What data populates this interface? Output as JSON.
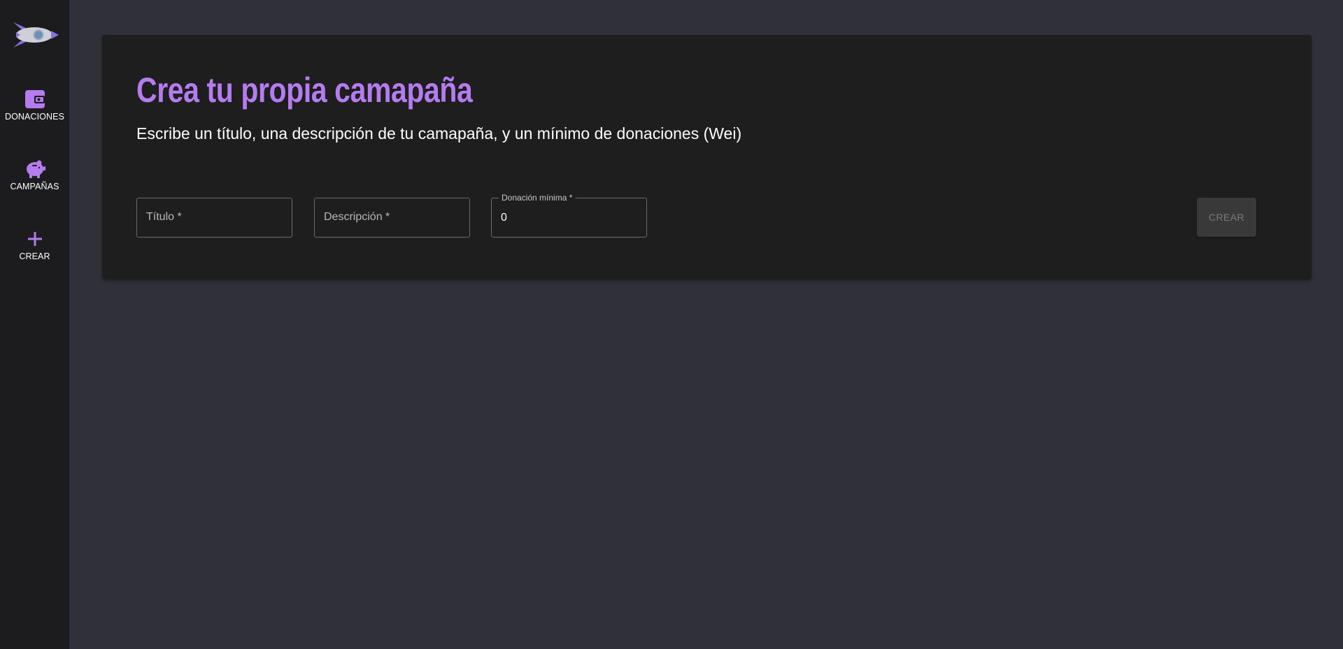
{
  "sidebar": {
    "logo_icon": "rocket-icon",
    "items": [
      {
        "label": "DONACIONES",
        "icon": "wallet-icon"
      },
      {
        "label": "CAMPAÑAS",
        "icon": "piggy-bank-icon"
      },
      {
        "label": "CREAR",
        "icon": "plus-icon"
      }
    ]
  },
  "form": {
    "title": "Crea tu propia camapaña",
    "subtitle": "Escribe un título, una descripción de tu camapaña, y un mínimo de donaciones (Wei)",
    "fields": {
      "titulo": {
        "placeholder": "Título *"
      },
      "descripcion": {
        "placeholder": "Descripción *"
      },
      "donacion_minima": {
        "label": "Donación mínima *",
        "value": "0"
      }
    },
    "submit_label": "CREAR"
  },
  "colors": {
    "accent": "#b57cf0",
    "page_bg": "#30303a",
    "sidebar_bg": "#1c1c1f",
    "card_bg": "#1e1e1e"
  }
}
